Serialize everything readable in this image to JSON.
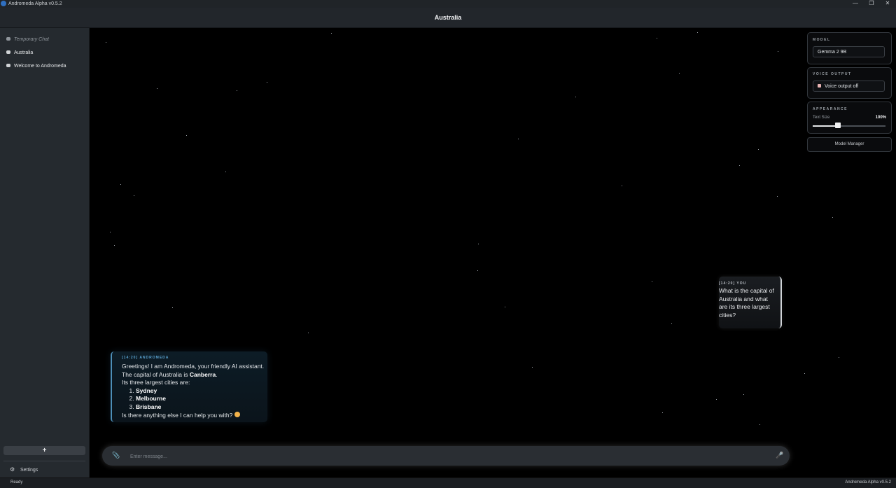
{
  "window": {
    "app_title": "Andromeda Alpha v0.5.2",
    "minimize_glyph": "—",
    "maximize_glyph": "❐",
    "close_glyph": "✕"
  },
  "header": {
    "chat_title": "Australia"
  },
  "sidebar": {
    "items": [
      {
        "label": "Temporary Chat",
        "icon": "chat-bubble-icon"
      },
      {
        "label": "Australia",
        "icon": "chat-bubble-icon"
      },
      {
        "label": "Welcome to Andromeda",
        "icon": "chat-bubble-icon"
      }
    ],
    "new_chat_label": "+",
    "settings_label": "Settings",
    "settings_icon": "⚙"
  },
  "messages": {
    "user": {
      "meta": "[14:20] YOU",
      "text": "What is the capital of Australia and what are its three largest cities?"
    },
    "bot": {
      "meta": "[14:20] ANDROMEDA",
      "line1": "Greetings! I am Andromeda, your friendly AI assistant.",
      "line2_prefix": "The capital of Australia is ",
      "line2_bold": "Canberra",
      "line2_suffix": ".",
      "line3": "Its three largest cities are:",
      "cities": [
        "Sydney",
        "Melbourne",
        "Brisbane"
      ],
      "line4": "Is there anything else I can help you with?"
    }
  },
  "input": {
    "placeholder": "Enter message...",
    "attach_icon": "paperclip-icon",
    "mic_icon": "microphone-icon"
  },
  "right_panel": {
    "model_label": "MODEL",
    "model_value": "Gemma 2 9B",
    "voice_label": "VOICE OUTPUT",
    "voice_value": "Voice output off",
    "appearance_label": "APPEARANCE",
    "text_size_label": "Text Size",
    "text_size_value": "100%",
    "text_size_fraction": 0.35,
    "model_manager_label": "Model Manager"
  },
  "status": {
    "left": "Ready",
    "right": "Andromeda Alpha v0.5.2"
  },
  "colors": {
    "background": "#000000",
    "sidebar": "#252a2f",
    "bot_accent": "#4d8fb8",
    "user_accent": "#cfd3d7"
  }
}
